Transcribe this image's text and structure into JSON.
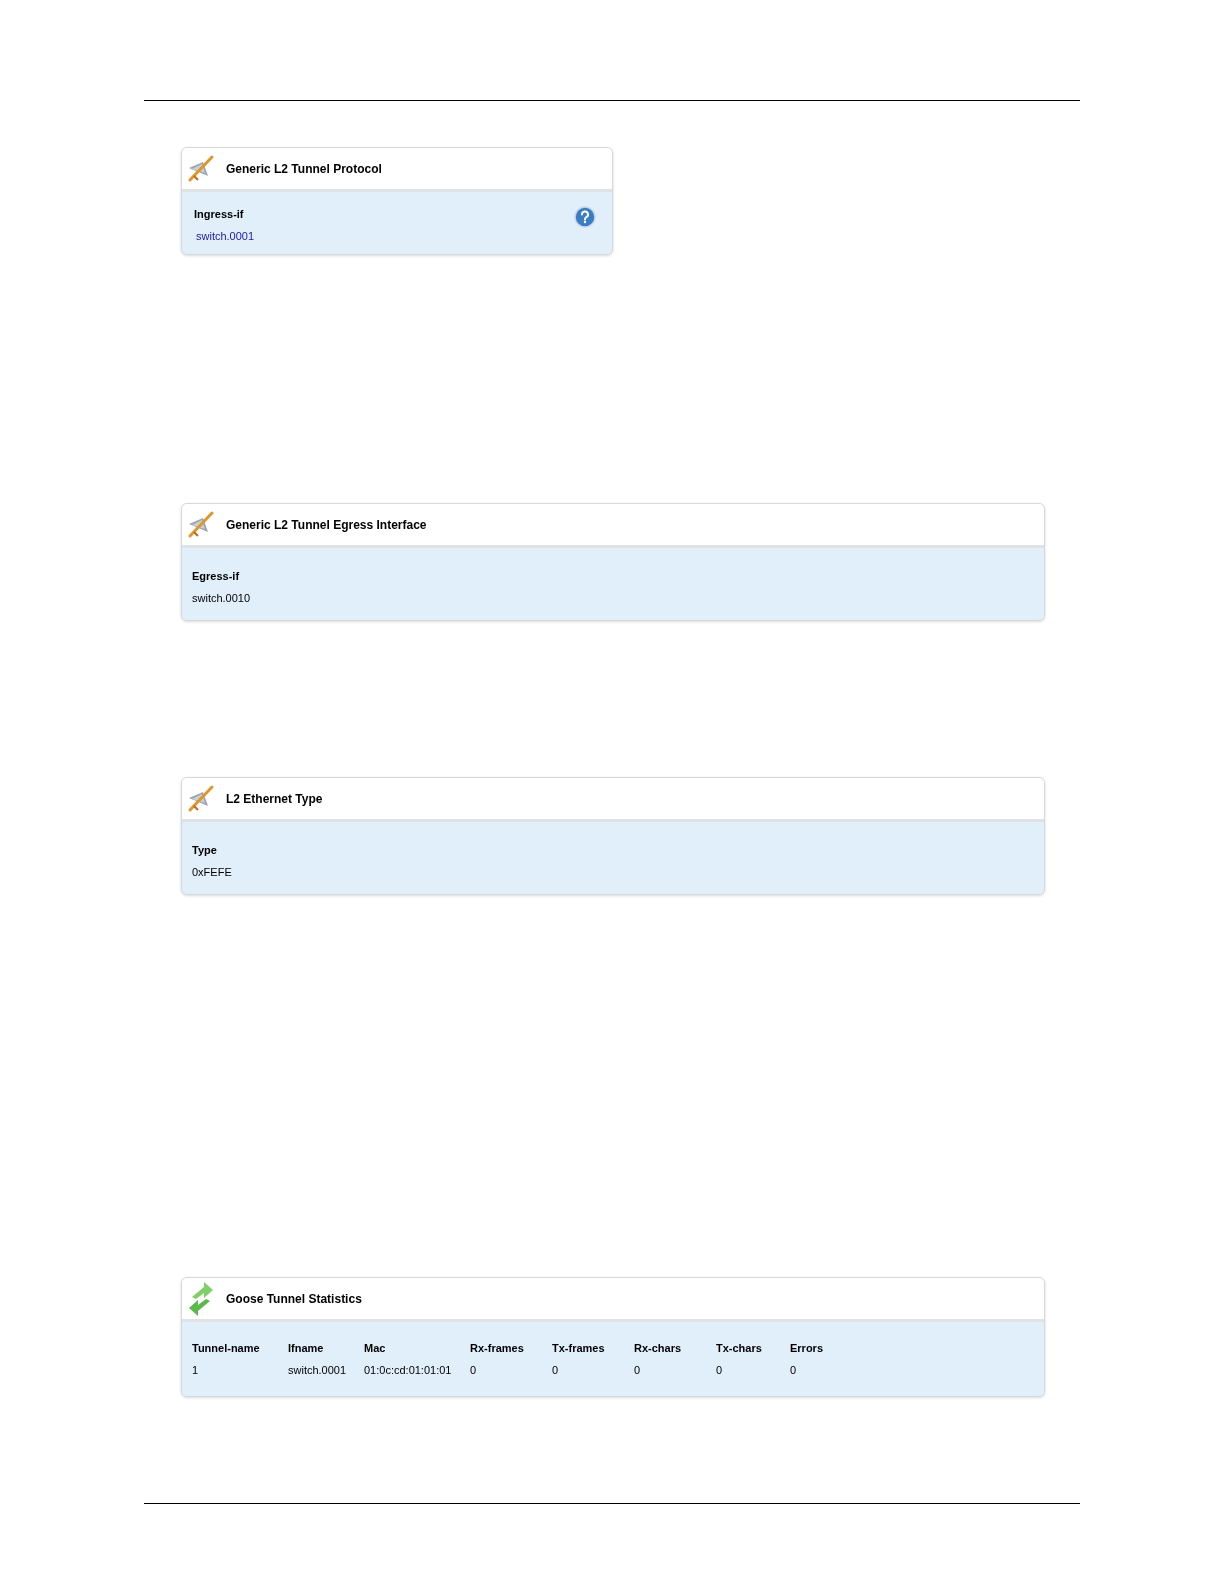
{
  "panels": [
    {
      "kind": "fields",
      "title": "Generic L2 Tunnel Protocol",
      "help": true,
      "fields": [
        {
          "label": "Ingress-if",
          "value": "switch.0001",
          "link": true
        }
      ]
    },
    {
      "kind": "fields",
      "title": "Generic L2 Tunnel Egress Interface",
      "help": false,
      "fields": [
        {
          "label": "Egress-if",
          "value": "switch.0010",
          "link": false
        }
      ]
    },
    {
      "kind": "fields",
      "title": "L2 Ethernet Type",
      "help": false,
      "fields": [
        {
          "label": "Type",
          "value": "0xFEFE",
          "link": false
        }
      ]
    },
    {
      "kind": "table",
      "title": "Goose Tunnel Statistics",
      "columns": [
        "Tunnel-name",
        "Ifname",
        "Mac",
        "Rx-frames",
        "Tx-frames",
        "Rx-chars",
        "Tx-chars",
        "Errors"
      ],
      "rows": [
        [
          "1",
          "switch.0001",
          "01:0c:cd:01:01:01",
          "0",
          "0",
          "0",
          "0",
          "0"
        ]
      ]
    }
  ]
}
